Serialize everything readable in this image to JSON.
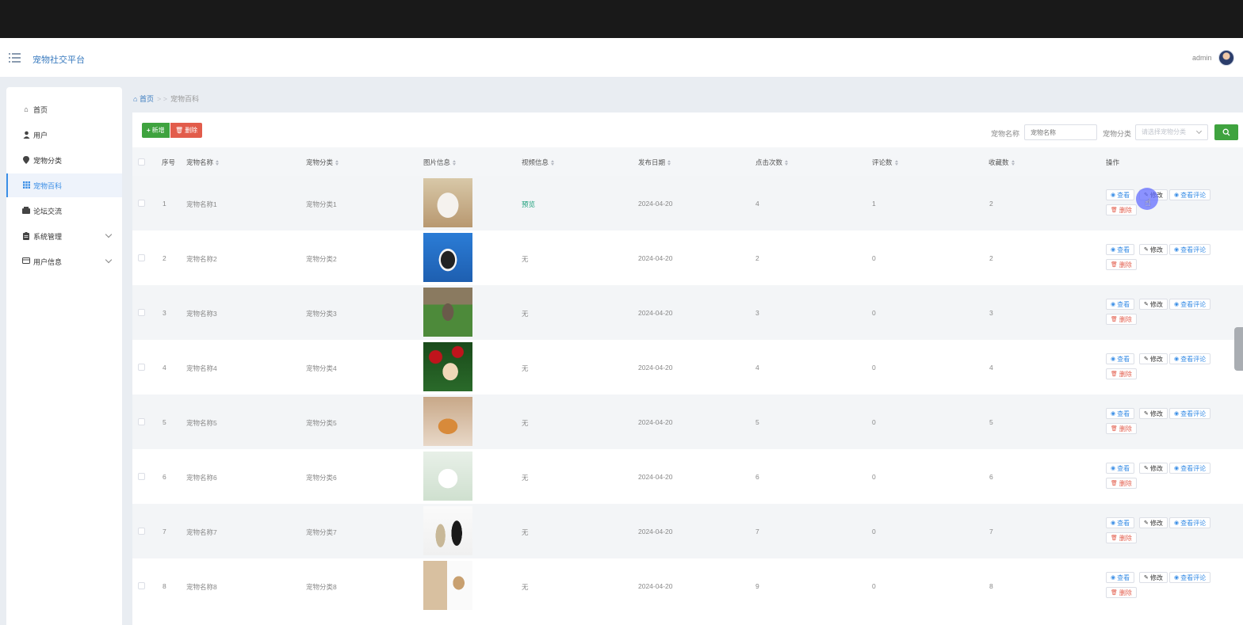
{
  "header": {
    "app_title": "宠物社交平台",
    "username": "admin",
    "avatar": "avatar-icon"
  },
  "sidebar": {
    "items": [
      {
        "label": "首页",
        "icon": "home-icon"
      },
      {
        "label": "用户",
        "icon": "user-icon"
      },
      {
        "label": "宠物分类",
        "icon": "pin-icon"
      },
      {
        "label": "宠物百科",
        "icon": "grid-icon",
        "active": true
      },
      {
        "label": "论坛交流",
        "icon": "wallet-icon"
      },
      {
        "label": "系统管理",
        "icon": "clipboard-icon",
        "expandable": true
      },
      {
        "label": "用户信息",
        "icon": "card-icon",
        "expandable": true
      }
    ]
  },
  "breadcrumb": {
    "home": "首页",
    "separator": "> >",
    "current": "宠物百科"
  },
  "toolbar": {
    "add_label": "新增",
    "delete_label": "删除"
  },
  "search": {
    "name_label": "宠物名称",
    "name_placeholder": "宠物名称",
    "category_label": "宠物分类",
    "category_placeholder": "请选择宠物分类"
  },
  "table": {
    "columns": [
      "序号",
      "宠物名称",
      "宠物分类",
      "图片信息",
      "视频信息",
      "发布日期",
      "点击次数",
      "评论数",
      "收藏数",
      "操作"
    ],
    "rows": [
      {
        "index": "1",
        "name": "宠物名称1",
        "category": "宠物分类1",
        "video": "预览",
        "date": "2024-04-20",
        "clicks": "4",
        "comments": "1",
        "favorites": "2"
      },
      {
        "index": "2",
        "name": "宠物名称2",
        "category": "宠物分类2",
        "video": "无",
        "date": "2024-04-20",
        "clicks": "2",
        "comments": "0",
        "favorites": "2"
      },
      {
        "index": "3",
        "name": "宠物名称3",
        "category": "宠物分类3",
        "video": "无",
        "date": "2024-04-20",
        "clicks": "3",
        "comments": "0",
        "favorites": "3"
      },
      {
        "index": "4",
        "name": "宠物名称4",
        "category": "宠物分类4",
        "video": "无",
        "date": "2024-04-20",
        "clicks": "4",
        "comments": "0",
        "favorites": "4"
      },
      {
        "index": "5",
        "name": "宠物名称5",
        "category": "宠物分类5",
        "video": "无",
        "date": "2024-04-20",
        "clicks": "5",
        "comments": "0",
        "favorites": "5"
      },
      {
        "index": "6",
        "name": "宠物名称6",
        "category": "宠物分类6",
        "video": "无",
        "date": "2024-04-20",
        "clicks": "6",
        "comments": "0",
        "favorites": "6"
      },
      {
        "index": "7",
        "name": "宠物名称7",
        "category": "宠物分类7",
        "video": "无",
        "date": "2024-04-20",
        "clicks": "7",
        "comments": "0",
        "favorites": "7"
      },
      {
        "index": "8",
        "name": "宠物名称8",
        "category": "宠物分类8",
        "video": "无",
        "date": "2024-04-20",
        "clicks": "9",
        "comments": "0",
        "favorites": "8"
      }
    ],
    "actions": {
      "view": "查看",
      "edit": "修改",
      "view_comments": "查看评论",
      "delete": "删除"
    }
  },
  "colors": {
    "accent": "#3a8ee6",
    "primary_green": "#3fa33f",
    "danger_red": "#e25c4b",
    "topbar": "#191919",
    "page_bg": "#e9edf2"
  }
}
